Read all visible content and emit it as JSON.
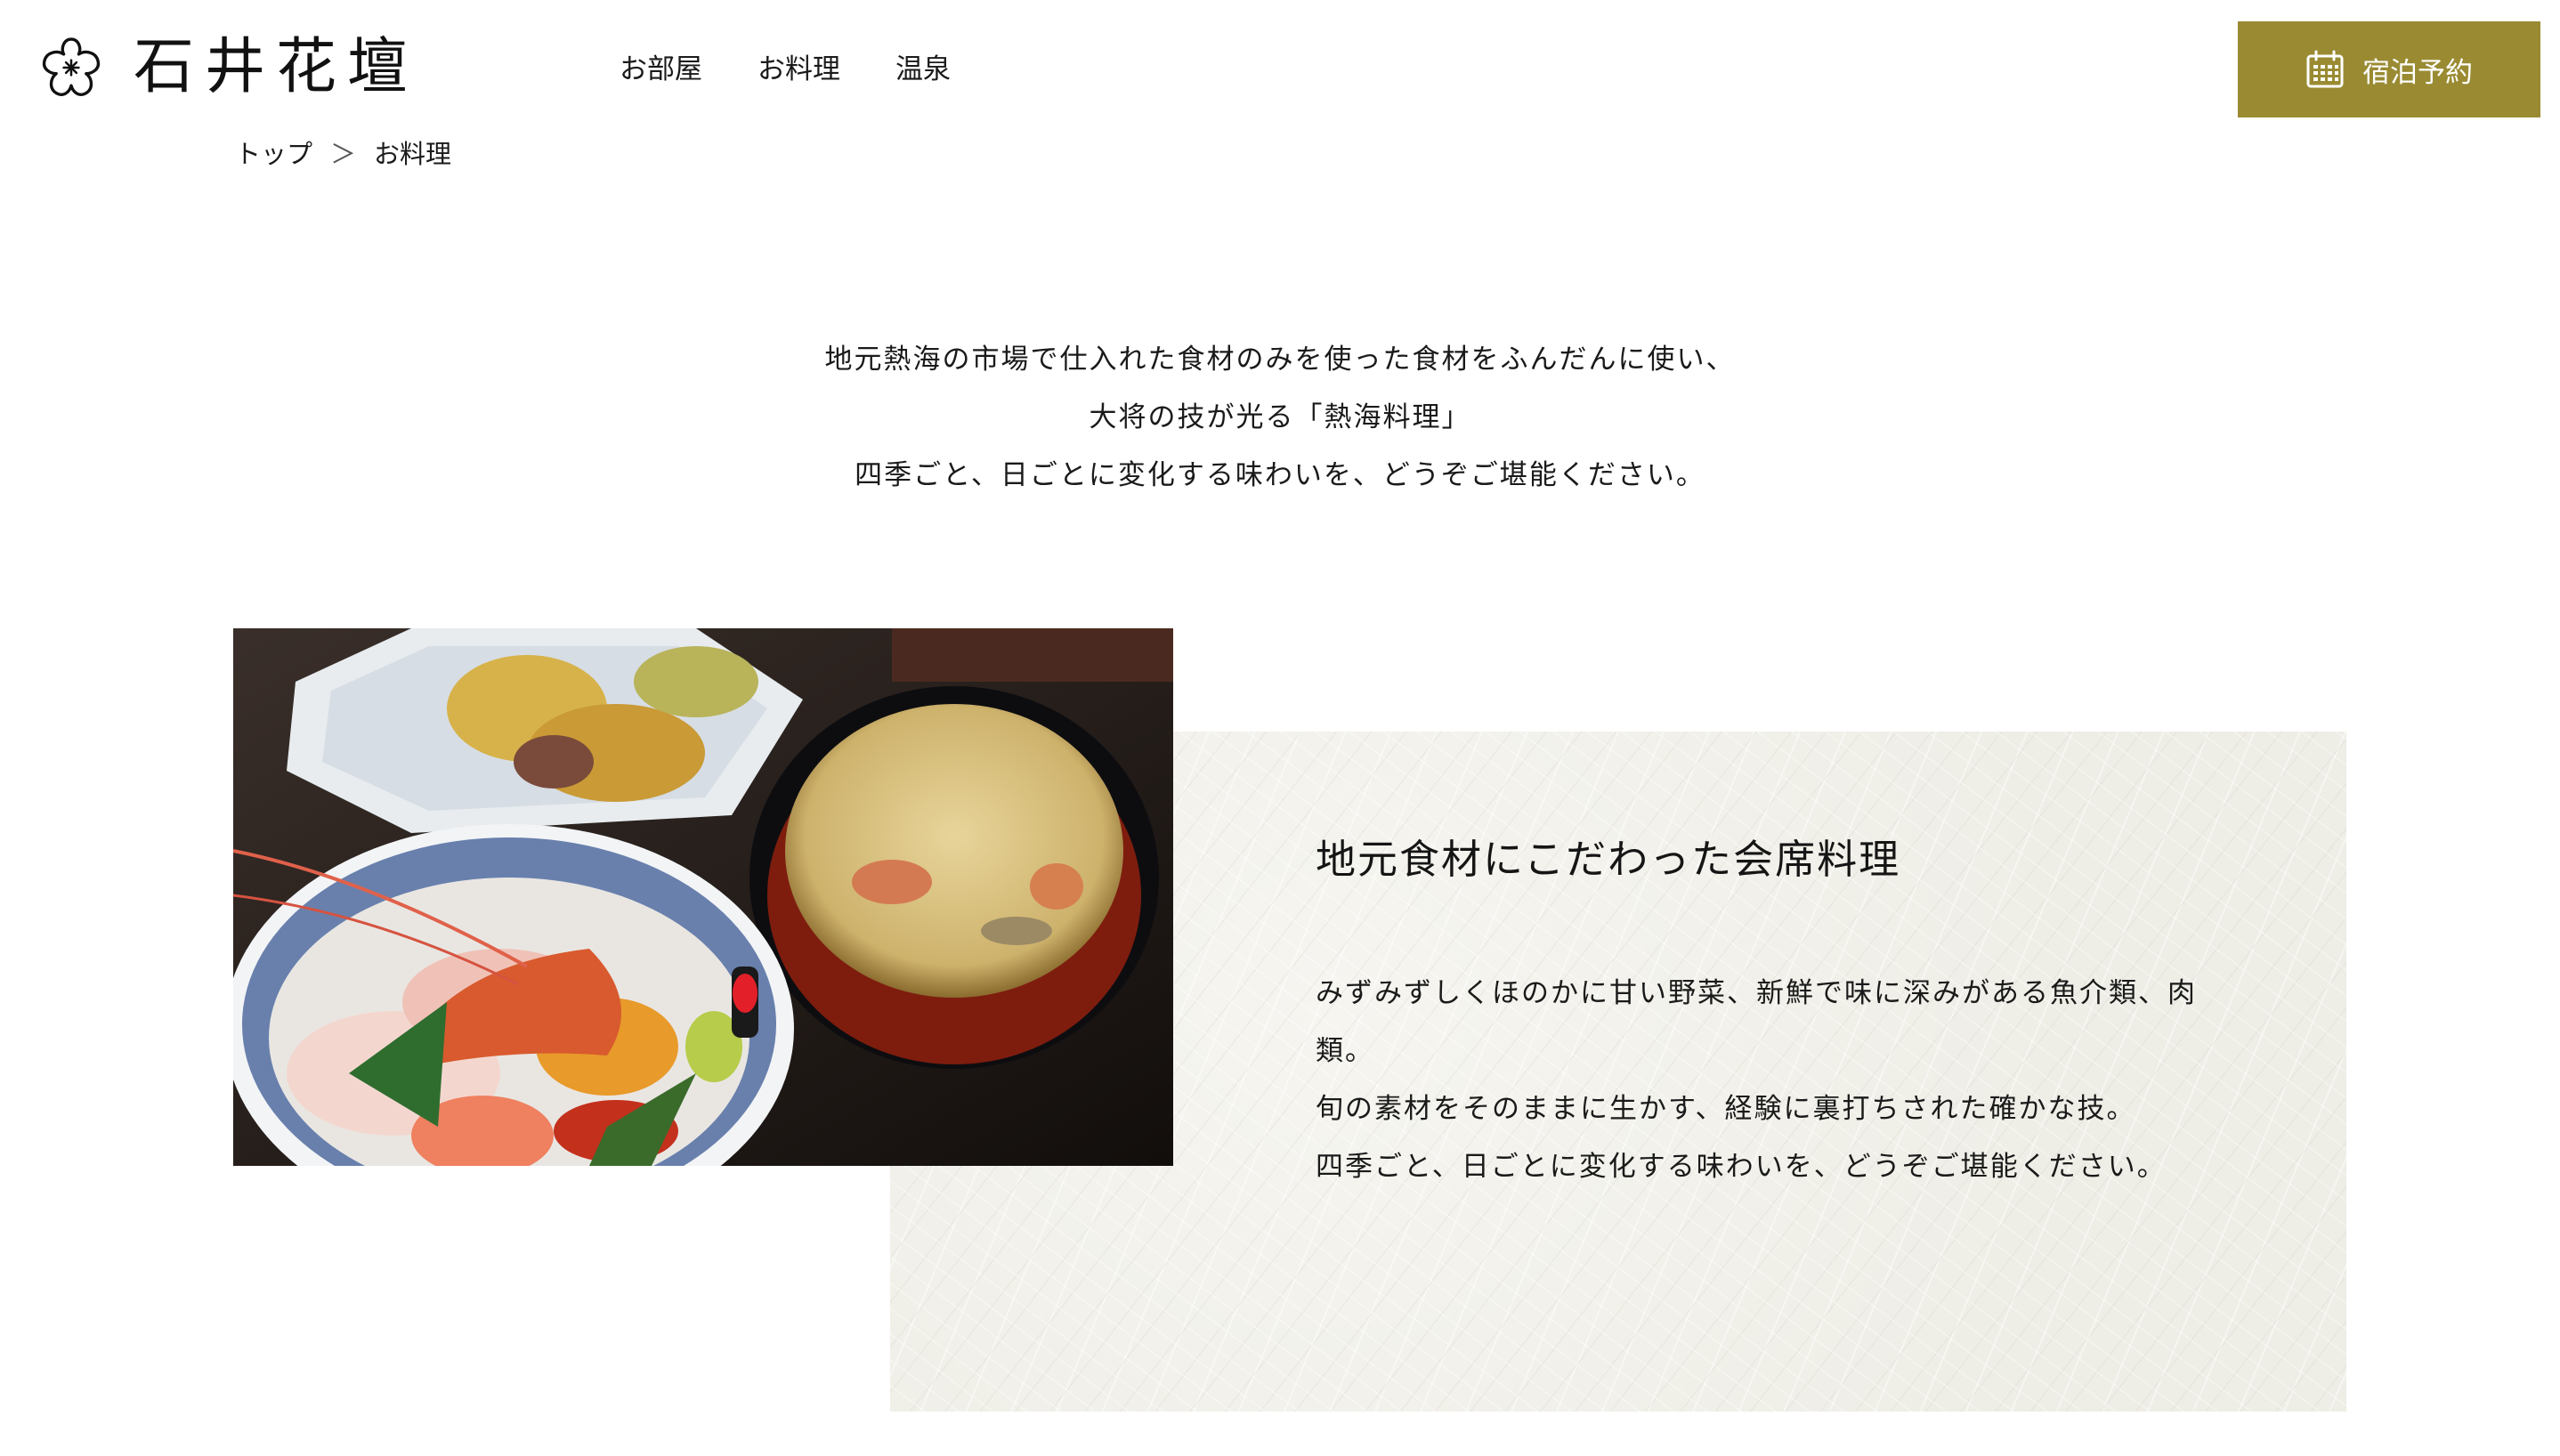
{
  "site": {
    "logo_text": "石井花壇",
    "logo_icon": "sakura-flower-icon"
  },
  "nav": {
    "items": [
      {
        "label": "お部屋"
      },
      {
        "label": "お料理"
      },
      {
        "label": "温泉"
      }
    ]
  },
  "reserve": {
    "label": "宿泊予約",
    "icon": "calendar-icon",
    "color": "#9a8b33"
  },
  "breadcrumb": {
    "home": "トップ",
    "separator": "＞",
    "current": "お料理"
  },
  "intro": {
    "lines": [
      "地元熱海の市場で仕入れた食材のみを使った食材をふんだんに使い、",
      "大将の技が光る「熱海料理」",
      "四季ごと、日ごとに変化する味わいを、どうぞご堪能ください。"
    ]
  },
  "feature": {
    "title": "地元食材にこだわった会席料理",
    "lines": [
      "みずみずしくほのかに甘い野菜、新鮮で味に深みがある魚介類、肉",
      "類。",
      "旬の素材をそのままに生かす、経験に裏打ちされた確かな技。",
      "四季ごと、日ごとに変化する味わいを、どうぞご堪能ください。"
    ],
    "image_subject": "food-photo"
  }
}
